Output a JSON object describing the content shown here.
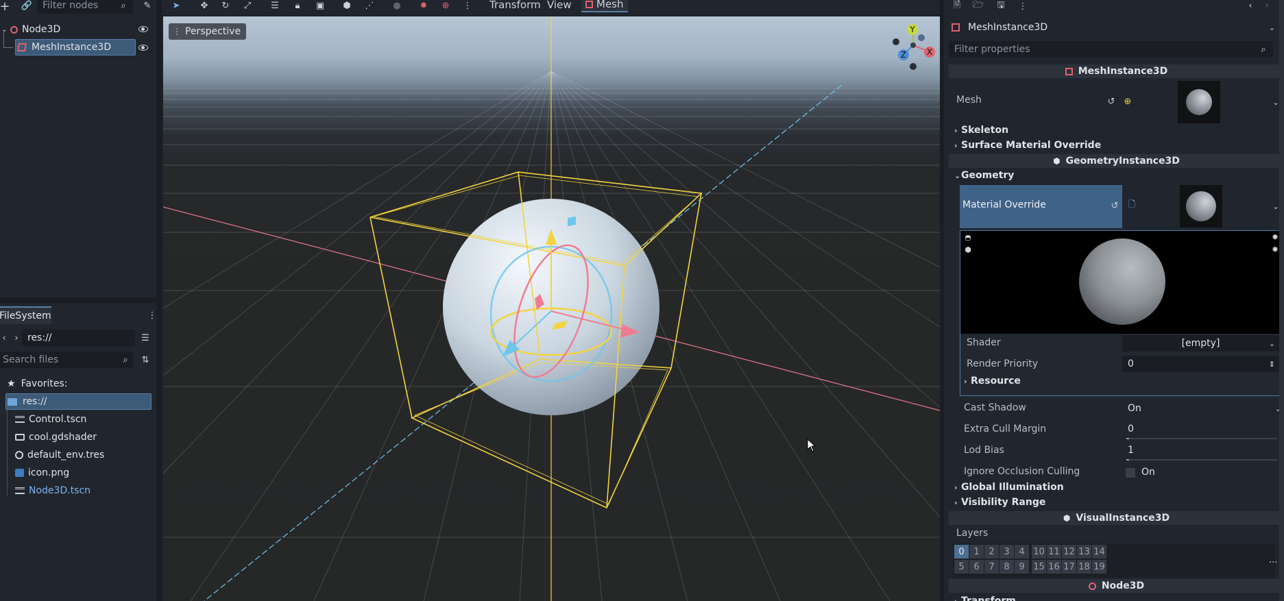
{
  "scene_dock": {
    "filter_placeholder": "Filter nodes",
    "tree": [
      {
        "label": "Node3D"
      },
      {
        "label": "MeshInstance3D"
      }
    ]
  },
  "filesystem": {
    "tab_label": "FileSystem",
    "path": "res://",
    "search_placeholder": "Search files",
    "favorites_label": "Favorites:",
    "root_label": "res://",
    "files": [
      {
        "name": "Control.tscn",
        "icon": "scene-icon"
      },
      {
        "name": "cool.gdshader",
        "icon": "shader-icon"
      },
      {
        "name": "default_env.tres",
        "icon": "globe-icon"
      },
      {
        "name": "icon.png",
        "icon": "image-icon"
      },
      {
        "name": "Node3D.tscn",
        "icon": "scene-icon"
      }
    ]
  },
  "viewport": {
    "menu": {
      "transform": "Transform",
      "view": "View",
      "mesh": "Mesh"
    },
    "perspective_label": "Perspective",
    "gizmo_axes": {
      "y": "Y",
      "x": "X",
      "z": "Z"
    }
  },
  "inspector": {
    "node_name": "MeshInstance3D",
    "filter_placeholder": "Filter properties",
    "sections": {
      "mesh_instance": "MeshInstance3D",
      "geometry_instance": "GeometryInstance3D",
      "visual_instance": "VisualInstance3D",
      "node3d": "Node3D"
    },
    "mesh_label": "Mesh",
    "skeleton_label": "Skeleton",
    "surface_override_label": "Surface Material Override",
    "geometry_label": "Geometry",
    "material_override_label": "Material Override",
    "shader_label": "Shader",
    "shader_value": "[empty]",
    "render_priority_label": "Render Priority",
    "render_priority_value": "0",
    "resource_label": "Resource",
    "cast_shadow_label": "Cast Shadow",
    "cast_shadow_value": "On",
    "extra_cull_label": "Extra Cull Margin",
    "extra_cull_value": "0",
    "lod_bias_label": "Lod Bias",
    "lod_bias_value": "1",
    "ignore_occlusion_label": "Ignore Occlusion Culling",
    "ignore_occlusion_value": "On",
    "global_illumination_label": "Global Illumination",
    "visibility_range_label": "Visibility Range",
    "layers_label": "Layers",
    "layers_row1": [
      "0",
      "1",
      "2",
      "3",
      "4",
      "10",
      "11",
      "12",
      "13",
      "14"
    ],
    "layers_row2": [
      "5",
      "6",
      "7",
      "8",
      "9",
      "15",
      "16",
      "17",
      "18",
      "19"
    ],
    "transform_label": "Transform",
    "ellipsis": "..."
  },
  "colors": {
    "accent": "#4d6f91",
    "selection": "#3d5a78",
    "node_red": "#e0616f",
    "gizmo_yellow": "#f3d43f"
  }
}
